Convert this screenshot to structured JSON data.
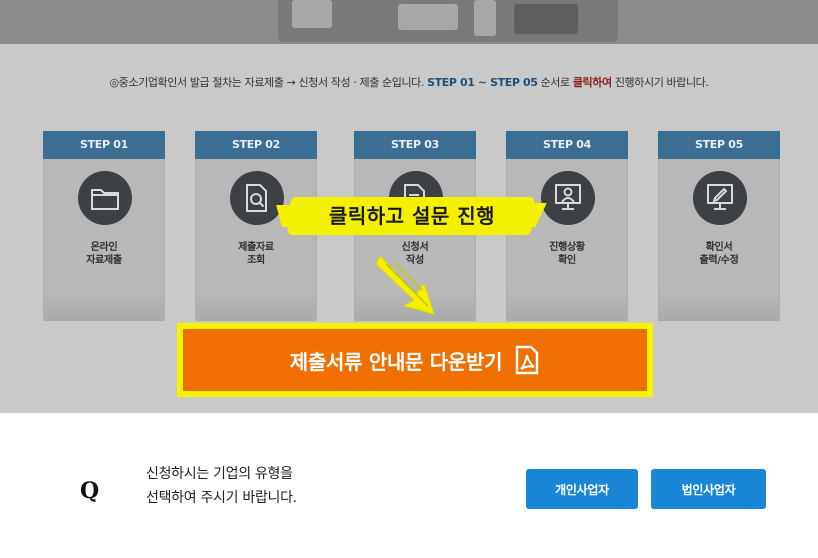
{
  "intro": {
    "prefix": "◎중소기업확인서 발급 절차는 자료제출 → 신청서 작성 · 제출 순입니다. ",
    "step_range": "STEP 01 ~ STEP 05",
    "middle": " 순서로 ",
    "click_word": "클릭하여",
    "suffix": " 진행하시기 바랍니다."
  },
  "steps": [
    {
      "tab": "STEP 01",
      "label_line1": "온라인",
      "label_line2": "자료제출",
      "icon": "folder-icon"
    },
    {
      "tab": "STEP 02",
      "label_line1": "제출자료",
      "label_line2": "조회",
      "icon": "document-search-icon"
    },
    {
      "tab": "STEP 03",
      "label_line1": "신청서",
      "label_line2": "작성",
      "icon": "document-edit-icon"
    },
    {
      "tab": "STEP 04",
      "label_line1": "진행상황",
      "label_line2": "확인",
      "icon": "monitor-person-icon"
    },
    {
      "tab": "STEP 05",
      "label_line1": "확인서",
      "label_line2": "출력/수정",
      "icon": "monitor-pen-icon"
    }
  ],
  "annotation": {
    "text": "클릭하고 설문 진행",
    "color": "#f5f000"
  },
  "download": {
    "label": "제출서류 안내문 다운받기",
    "icon": "pdf-icon",
    "color": "#ef6f00"
  },
  "question": {
    "mark": "Q",
    "line1": "신청하시는 기업의 유형을",
    "line2": "선택하여 주시기 바랍니다."
  },
  "buttons": {
    "individual": "개인사업자",
    "corporate": "법인사업자",
    "color": "#1a87d6"
  }
}
